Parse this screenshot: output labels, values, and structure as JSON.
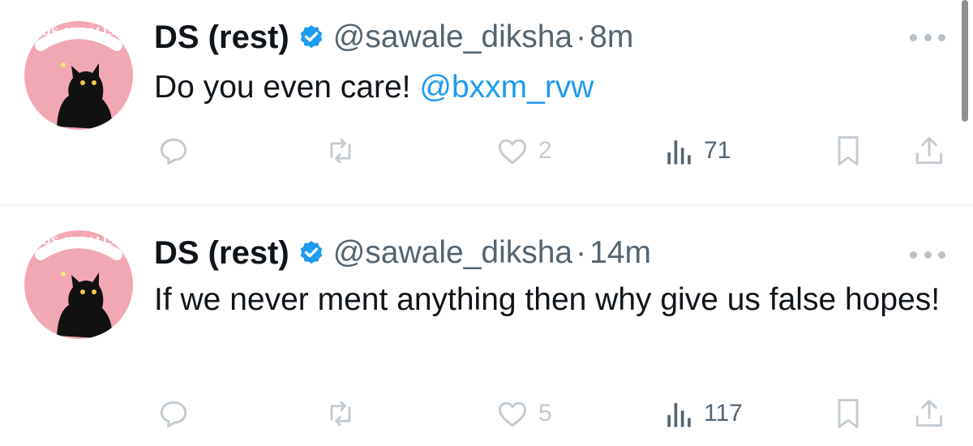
{
  "tweets": [
    {
      "avatar_text": "DS AURALIS",
      "name": "DS (rest)",
      "handle": "@sawale_diksha",
      "separator": "·",
      "time": "8m",
      "text": "Do you even care! ",
      "mention": "@bxxm_rvw",
      "likes": "2",
      "views": "71"
    },
    {
      "avatar_text": "DS AURALIS",
      "name": "DS (rest)",
      "handle": "@sawale_diksha",
      "separator": "·",
      "time": "14m",
      "text": "If we never ment anything then why give us false hopes!",
      "likes": "5",
      "views": "117"
    }
  ],
  "icons": {
    "reply": "reply-icon",
    "retweet": "retweet-icon",
    "like": "heart-icon",
    "views": "views-icon",
    "bookmark": "bookmark-icon",
    "share": "share-icon",
    "verified": "verified-badge-icon",
    "more": "more-icon"
  },
  "colors": {
    "mention": "#1d9bf0",
    "verified": "#1d9bf0",
    "secondary_text": "#536471",
    "faded_icon": "#c3cbd1",
    "avatar_bg": "#f2a7b4"
  }
}
